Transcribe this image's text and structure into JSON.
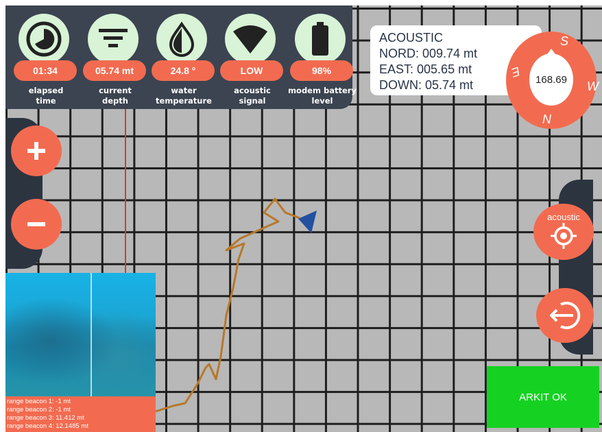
{
  "status": {
    "items": [
      {
        "id": "time",
        "icon": "elapsed-time-icon",
        "value": "01:34",
        "label_line1": "elapsed",
        "label_line2": "time"
      },
      {
        "id": "depth",
        "icon": "depth-icon",
        "value": "05.74 mt",
        "label_line1": "current",
        "label_line2": "depth"
      },
      {
        "id": "temp",
        "icon": "water-drop-icon",
        "value": "24.8 °",
        "label_line1": "water",
        "label_line2": "temperature"
      },
      {
        "id": "signal",
        "icon": "signal-icon",
        "value": "LOW",
        "label_line1": "acoustic",
        "label_line2": "signal"
      },
      {
        "id": "battery",
        "icon": "battery-icon",
        "value": "98%",
        "label_line1": "modem battery",
        "label_line2": "level"
      }
    ]
  },
  "coordinates": {
    "title": "ACOUSTIC",
    "nord": "NORD: 009.74 mt",
    "east": "EAST: 005.65 mt",
    "down": "DOWN: 05.74 mt"
  },
  "compass": {
    "heading": "168.69",
    "labels": {
      "s": "S",
      "w": "W",
      "n": "N",
      "e": "E"
    }
  },
  "buttons": {
    "zoom_in": "+",
    "zoom_out": "−",
    "acoustic_label": "acoustic"
  },
  "range": {
    "lines": [
      "range beacon 1: -1 mt",
      "range beacon 2: -1 mt",
      "range beacon 3: 11.412 mt",
      "range beacon 4: 12.1485 mt"
    ]
  },
  "arkit": {
    "label": "ARKIT OK"
  },
  "colors": {
    "accent": "#f26b50",
    "panel": "#3b4450",
    "icon_bg": "#d8f3d6",
    "track": "#b8782a",
    "vehicle": "#2450a0",
    "arkit": "#15d222"
  }
}
